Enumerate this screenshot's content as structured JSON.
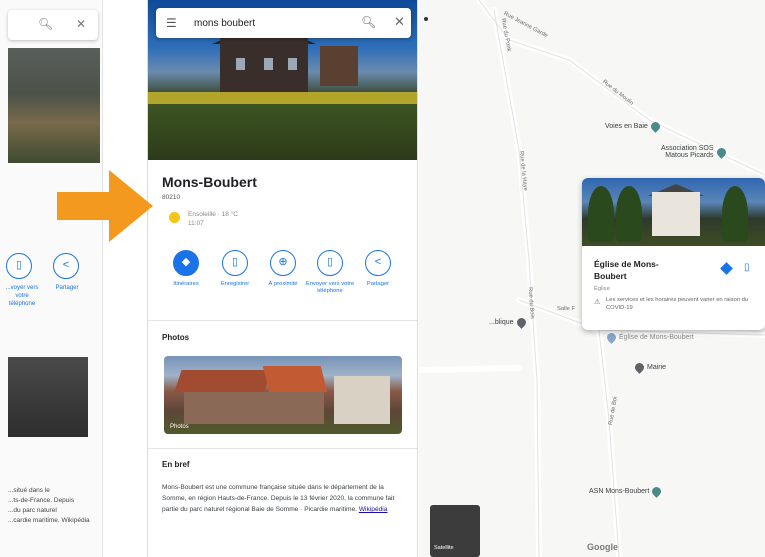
{
  "left_panel": {
    "actions": [
      {
        "label": "Envoyer vers votre téléphone",
        "icon": "phone-icon",
        "visible_label": "...voyer vers\nvotre\ntéléphone"
      },
      {
        "label": "Partager",
        "icon": "share-icon"
      }
    ],
    "partial_text": "...situé dans le\n...ts-de-France. Depuis\n...du parc naturel\n...cardie maritime.  Wikipédia"
  },
  "search": {
    "value": "mons boubert",
    "menu_icon": "menu-icon",
    "search_icon": "search-icon",
    "close_icon": "close-icon"
  },
  "place": {
    "title": "Mons-Boubert",
    "postal_code": "80210",
    "weather": "Ensoleillé · 18 °C",
    "time": "11:07",
    "actions": [
      {
        "label": "Itinéraires",
        "icon": "directions-icon"
      },
      {
        "label": "Enregistrer",
        "icon": "bookmark-icon"
      },
      {
        "label": "À proximité",
        "icon": "nearby-icon"
      },
      {
        "label": "Envoyer vers votre téléphone",
        "icon": "phone-icon"
      },
      {
        "label": "Partager",
        "icon": "share-icon"
      }
    ],
    "photos_heading": "Photos",
    "photo_caption": "Photos",
    "brief_heading": "En bref",
    "brief_text": "Mons-Boubert est une commune française située dans le département de la Somme, en région Hauts-de-France. Depuis le 13 février 2020, la commune fait partie du parc naturel régional Baie de Somme · Picardie maritime.",
    "brief_link": "Wikipédia"
  },
  "map": {
    "road_labels": [
      "Rue Jeanne Garde",
      "Rue du Ponk",
      "Rue du Moulin",
      "Rue de la Haye",
      "Salle F",
      "Rue du Bois",
      "Rue de Boi"
    ],
    "pois": [
      {
        "label": "Voies en Baie"
      },
      {
        "label": "Association SOS\nMatous Picards"
      },
      {
        "label": "...blique"
      },
      {
        "label": "Église de Mons-Boubert"
      },
      {
        "label": "Mairie"
      },
      {
        "label": "ASN Mons-Boubert"
      }
    ],
    "card": {
      "title": "Église de Mons-Boubert",
      "type": "Église",
      "note": "Les services et les horaires peuvent varier en raison du COVID-19",
      "directions_icon": "directions-icon",
      "save_icon": "bookmark-icon"
    },
    "satellite_label": "Satellite",
    "brand": "Google"
  },
  "colors": {
    "accent": "#1a73e8",
    "arrow": "#f39a1e",
    "sun": "#f5c518"
  }
}
